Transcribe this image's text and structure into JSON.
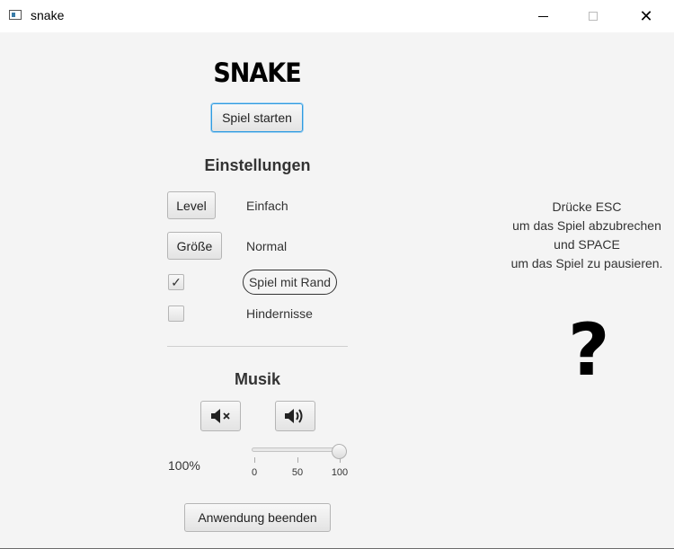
{
  "window": {
    "title": "snake"
  },
  "main": {
    "logo": "SNAKE",
    "start_button": "Spiel starten",
    "settings_heading": "Einstellungen",
    "level_button": "Level",
    "level_value": "Einfach",
    "size_button": "Größe",
    "size_value": "Normal",
    "border_checkbox": {
      "checked": true,
      "mark": "✓",
      "label": "Spiel mit Rand"
    },
    "obstacles_checkbox": {
      "checked": false,
      "label": "Hindernisse"
    },
    "music_heading": "Musik",
    "mute_icon": "speaker-mute-icon",
    "volume_icon": "speaker-volume-icon",
    "volume_label": "100%",
    "volume_slider": {
      "value": 100,
      "min": 0,
      "max": 100,
      "ticks": [
        "0",
        "50",
        "100"
      ]
    },
    "quit_button": "Anwendung beenden"
  },
  "help": {
    "lines": [
      "Drücke ESC",
      "um das Spiel abzubrechen",
      "und SPACE",
      "um das Spiel zu pausieren."
    ],
    "symbol": "?"
  }
}
